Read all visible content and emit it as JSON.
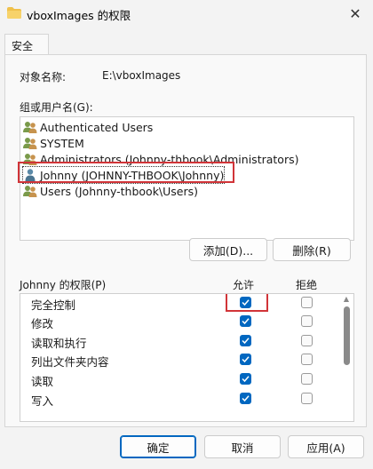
{
  "window": {
    "title": "vboxImages 的权限"
  },
  "tabs": [
    {
      "label": "安全"
    }
  ],
  "object": {
    "label": "对象名称:",
    "value": "E:\\vboxImages"
  },
  "groups": {
    "label": "组或用户名(G):",
    "items": [
      {
        "label": "Authenticated Users",
        "icon": "users-group-icon"
      },
      {
        "label": "SYSTEM",
        "icon": "users-group-icon"
      },
      {
        "label": "Administrators (Johnny-thbook\\Administrators)",
        "icon": "users-group-icon"
      },
      {
        "label": "Johnny (JOHNNY-THBOOK\\Johnny)",
        "icon": "user-icon",
        "selected": true
      },
      {
        "label": "Users (Johnny-thbook\\Users)",
        "icon": "users-group-icon"
      }
    ]
  },
  "buttons": {
    "add": "添加(D)...",
    "remove": "删除(R)",
    "ok": "确定",
    "cancel": "取消",
    "apply": "应用(A)"
  },
  "permissions": {
    "title": "Johnny 的权限(P)",
    "allow_header": "允许",
    "deny_header": "拒绝",
    "rows": [
      {
        "name": "完全控制",
        "allow": true,
        "deny": false
      },
      {
        "name": "修改",
        "allow": true,
        "deny": false
      },
      {
        "name": "读取和执行",
        "allow": true,
        "deny": false
      },
      {
        "name": "列出文件夹内容",
        "allow": true,
        "deny": false
      },
      {
        "name": "读取",
        "allow": true,
        "deny": false
      },
      {
        "name": "写入",
        "allow": true,
        "deny": false
      }
    ]
  },
  "colors": {
    "accent": "#0067c0",
    "highlight": "#d13438"
  }
}
